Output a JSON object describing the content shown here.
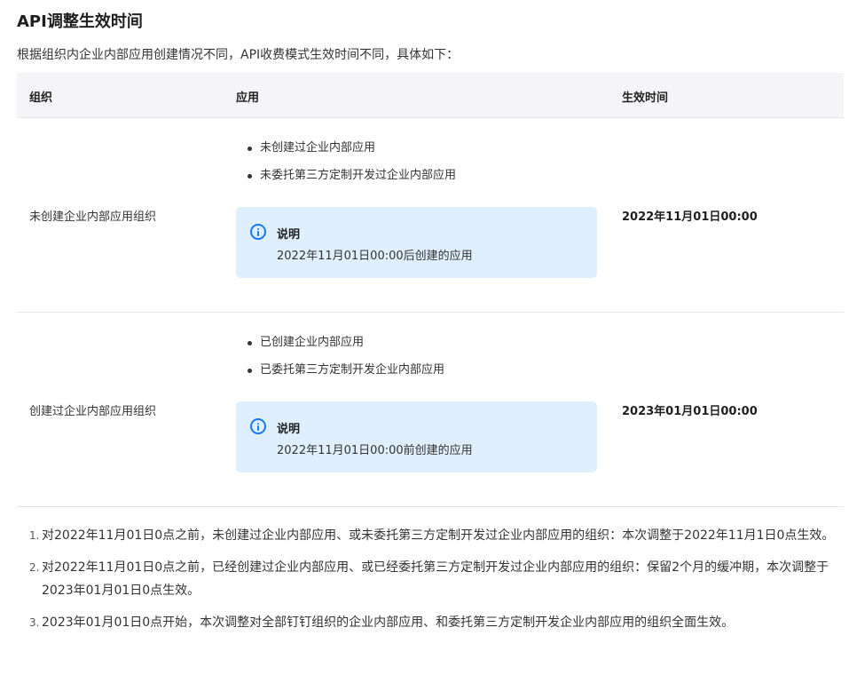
{
  "title": "API调整生效时间",
  "intro": "根据组织内企业内部应用创建情况不同，API收费模式生效时间不同，具体如下：",
  "table": {
    "headers": {
      "org": "组织",
      "app": "应用",
      "time": "生效时间"
    },
    "rows": [
      {
        "org": "未创建企业内部应用组织",
        "bullets": [
          "未创建过企业内部应用",
          "未委托第三方定制开发过企业内部应用"
        ],
        "note_title": "说明",
        "note_text": "2022年11月01日00:00后创建的应用",
        "time": "2022年11月01日00:00"
      },
      {
        "org": "创建过企业内部应用组织",
        "bullets": [
          "已创建企业内部应用",
          "已委托第三方定制开发企业内部应用"
        ],
        "note_title": "说明",
        "note_text": "2022年11月01日00:00前创建的应用",
        "time": "2023年01月01日00:00"
      }
    ]
  },
  "footnotes": [
    {
      "num": "1.",
      "text": "对2022年11月01日0点之前，未创建过企业内部应用、或未委托第三方定制开发过企业内部应用的组织：本次调整于2022年11月1日0点生效。"
    },
    {
      "num": "2.",
      "text": "对2022年11月01日0点之前，已经创建过企业内部应用、或已经委托第三方定制开发过企业内部应用的组织：保留2个月的缓冲期，本次调整于2023年01月01日0点生效。"
    },
    {
      "num": "3.",
      "text": "2023年01月01日0点开始，本次调整对全部钉钉组织的企业内部应用、和委托第三方定制开发企业内部应用的组织全面生效。"
    }
  ],
  "colors": {
    "header_bg": "#f5f5f7",
    "note_bg": "#e0effd",
    "info_icon": "#1677ff",
    "border": "#e6e6e6"
  },
  "icons": {
    "note": "info-circle-icon"
  }
}
